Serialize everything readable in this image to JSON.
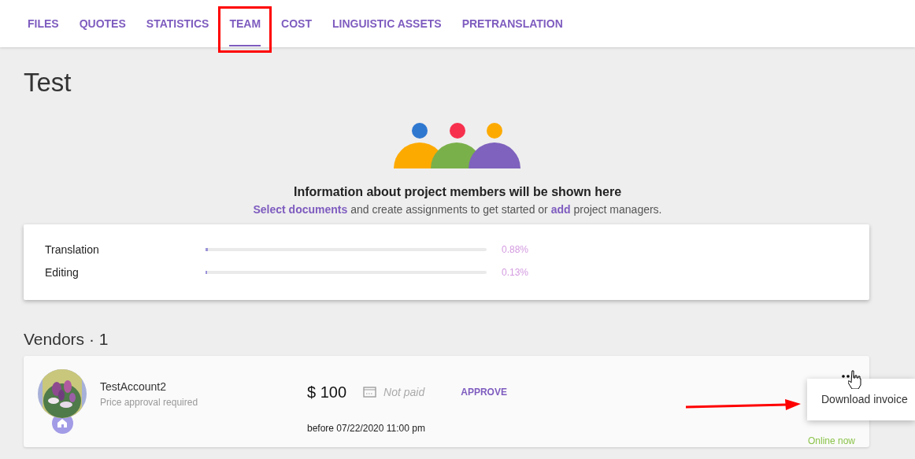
{
  "tabs": [
    {
      "label": "FILES",
      "selected": false,
      "annotated": false
    },
    {
      "label": "QUOTES",
      "selected": false,
      "annotated": false
    },
    {
      "label": "STATISTICS",
      "selected": false,
      "annotated": false
    },
    {
      "label": "TEAM",
      "selected": true,
      "annotated": true
    },
    {
      "label": "COST",
      "selected": false,
      "annotated": false
    },
    {
      "label": "LINGUISTIC ASSETS",
      "selected": false,
      "annotated": false
    },
    {
      "label": "PRETRANSLATION",
      "selected": false,
      "annotated": false
    }
  ],
  "page_title": "Test",
  "empty_state": {
    "heading": "Information about project members will be shown here",
    "text": "**Select documents** and create assignments to get started or **add** project managers."
  },
  "progress": [
    {
      "name": "Translation",
      "level": 0.0088,
      "reading": "0.88%"
    },
    {
      "name": "Editing",
      "level": 0.0013,
      "reading": "0.13%"
    }
  ],
  "vendors_heading": "Vendors · 1",
  "vendors": [
    {
      "name": "TestAccount2",
      "note": "Price approval required",
      "amount": "$ 100",
      "payment": "Not paid",
      "action": "APPROVE",
      "deadline": "before 07/22/2020 11:00 pm",
      "presence": "Online now"
    }
  ],
  "menu": {
    "items": [
      "Download invoice"
    ]
  }
}
